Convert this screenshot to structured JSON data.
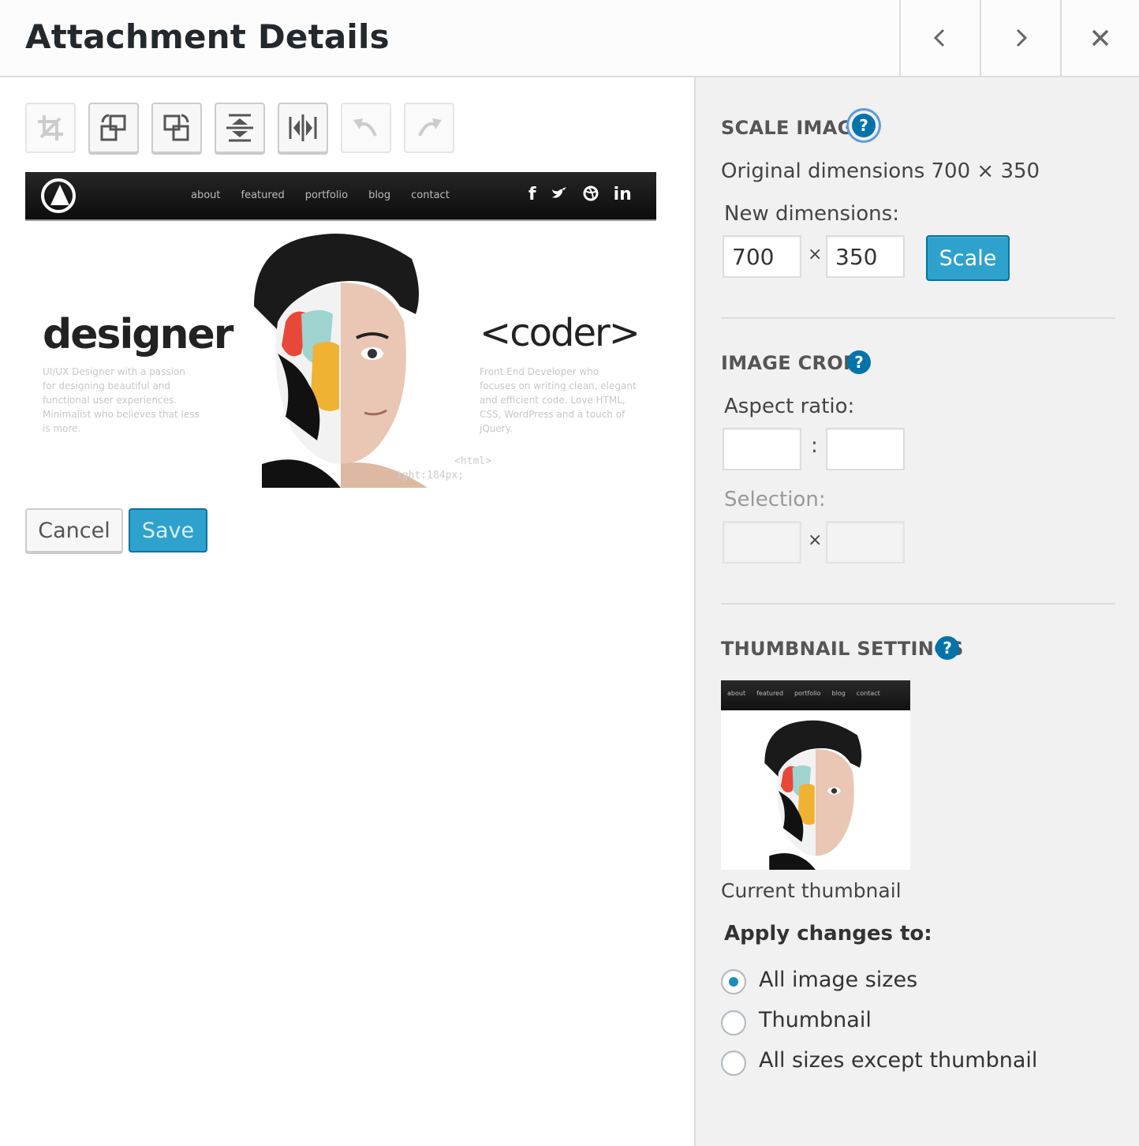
{
  "header": {
    "title": "Attachment Details",
    "prev_icon": "chevron-left-icon",
    "next_icon": "chevron-right-icon",
    "close_icon": "close-icon"
  },
  "toolbar": [
    {
      "name": "crop",
      "icon": "crop-icon",
      "enabled": false
    },
    {
      "name": "rotate-left",
      "icon": "rotate-left-icon",
      "enabled": true
    },
    {
      "name": "rotate-right",
      "icon": "rotate-right-icon",
      "enabled": true
    },
    {
      "name": "flip-vertical",
      "icon": "flip-vertical-icon",
      "enabled": true
    },
    {
      "name": "flip-horizontal",
      "icon": "flip-horizontal-icon",
      "enabled": true
    },
    {
      "name": "undo",
      "icon": "undo-icon",
      "enabled": false
    },
    {
      "name": "redo",
      "icon": "redo-icon",
      "enabled": false
    }
  ],
  "preview": {
    "nav_links": [
      "about",
      "featured",
      "portfolio",
      "blog",
      "contact"
    ],
    "social": [
      "f",
      "t",
      "d",
      "in"
    ],
    "headline_left": "designer",
    "headline_right": "<coder>",
    "blurb_left": "UI/UX Designer with a passion for designing beautiful and functional user experiences. Minimalist who believes that less is more.",
    "blurb_right": "Front End Developer who focuses on writing clean, elegant and efficient code. Love HTML, CSS, WordPress and a touch of jQuery.",
    "code_line_1": "<html>",
    "code_line_2": "ight:184px;"
  },
  "actions": {
    "cancel_label": "Cancel",
    "save_label": "Save"
  },
  "scale": {
    "title": "SCALE IMAGE",
    "help": "?",
    "original": "Original dimensions 700 × 350",
    "new_label": "New dimensions:",
    "width": "700",
    "height": "350",
    "times": "×",
    "button": "Scale"
  },
  "crop": {
    "title": "IMAGE CROP",
    "help": "?",
    "aspect_label": "Aspect ratio:",
    "aspect_sep": ":",
    "aspect_w": "",
    "aspect_h": "",
    "selection_label": "Selection:",
    "selection_sep": "×",
    "selection_w": "",
    "selection_h": ""
  },
  "thumbnail": {
    "title": "THUMBNAIL SETTINGS",
    "help": "?",
    "nav_links": [
      "about",
      "featured",
      "portfolio",
      "blog",
      "contact"
    ],
    "caption": "Current thumbnail",
    "apply_label": "Apply changes to:",
    "options": [
      {
        "label": "All image sizes",
        "checked": true
      },
      {
        "label": "Thumbnail",
        "checked": false
      },
      {
        "label": "All sizes except thumbnail",
        "checked": false
      }
    ]
  },
  "colors": {
    "accent": "#0073aa",
    "button_primary": "#2ea2cc",
    "sidebar_bg": "#f1f1f1"
  }
}
